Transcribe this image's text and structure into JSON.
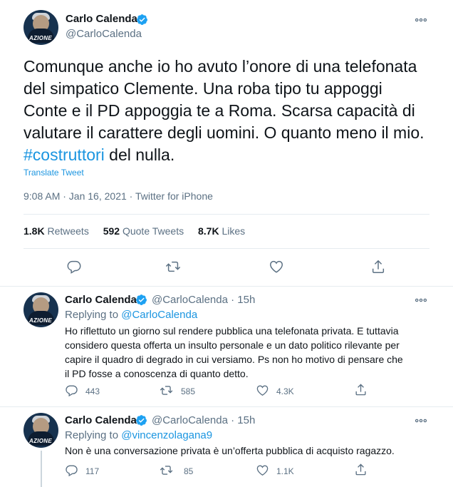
{
  "main_tweet": {
    "author_name": "Carlo Calenda",
    "author_handle": "@CarloCalenda",
    "avatar_badge": "AZIONE",
    "text_lines": [
      "Comunque anche io ho avuto l’onore di una telefonata",
      "del simpatico Clemente. Una roba tipo tu appoggi",
      "Conte e il PD appoggia te a Roma. Scarsa capacità di",
      "valutare il carattere degli uomini. O quanto meno il mio."
    ],
    "hashtag": "#costruttori",
    "text_tail": " del nulla.",
    "translate_label": "Translate Tweet",
    "meta": "9:08 AM · Jan 16, 2021 · Twitter for iPhone",
    "stats": {
      "retweets_count": "1.8K",
      "retweets_label": " Retweets",
      "quotes_count": "592",
      "quotes_label": " Quote Tweets",
      "likes_count": "8.7K",
      "likes_label": " Likes"
    }
  },
  "replies": [
    {
      "author_name": "Carlo Calenda",
      "author_handle": "@CarloCalenda · 15h",
      "replying_label": "Replying to ",
      "replying_mention": "@CarloCalenda",
      "text_lines": [
        "Ho riflettuto un giorno sul rendere pubblica una telefonata privata. E tuttavia",
        "considero questa offerta un insulto personale e un dato politico rilevante per",
        "capire il quadro di degrado in cui versiamo. Ps non ho motivo di pensare che",
        "il PD fosse a conoscenza di quanto detto."
      ],
      "reply_count": "443",
      "retweet_count": "585",
      "like_count": "4.3K"
    },
    {
      "author_name": "Carlo Calenda",
      "author_handle": "@CarloCalenda · 15h",
      "replying_label": "Replying to ",
      "replying_mention": "@vincenzolagana9",
      "text_lines": [
        "Non è una conversazione privata è un’offerta pubblica di acquisto ragazzo."
      ],
      "reply_count": "117",
      "retweet_count": "85",
      "like_count": "1.1K"
    }
  ],
  "colors": {
    "link": "#1b95e0",
    "verified": "#1da1f2",
    "secondary_text": "#5b7083",
    "divider": "#e6ecf0"
  },
  "icons": [
    "verified-badge-icon",
    "more-icon",
    "reply-icon",
    "retweet-icon",
    "like-icon",
    "share-icon"
  ]
}
